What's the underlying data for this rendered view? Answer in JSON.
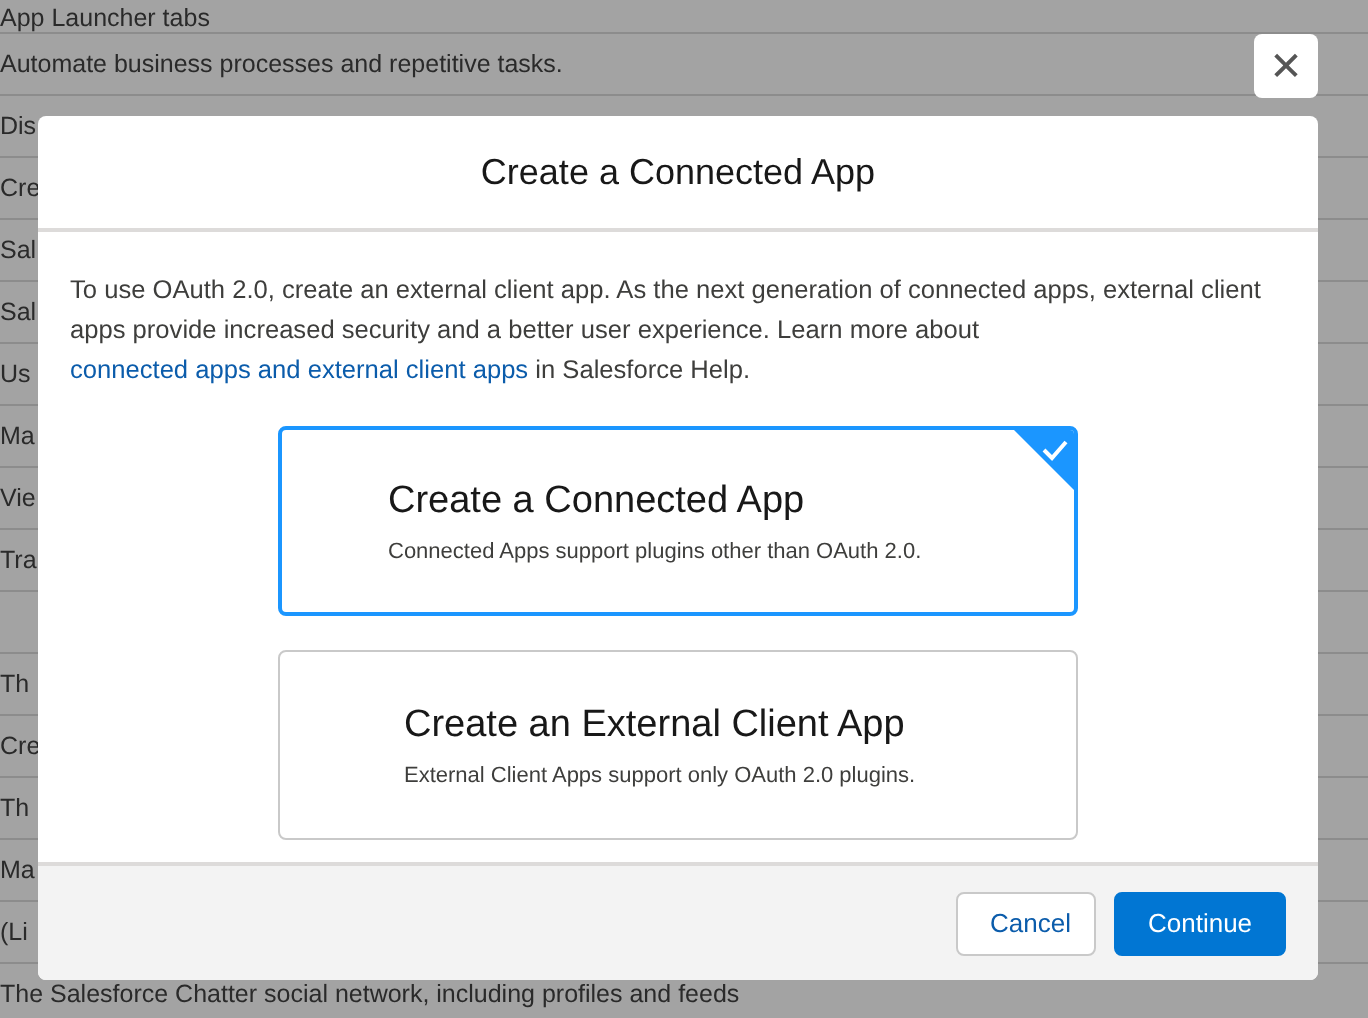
{
  "background_rows": [
    "App Launcher tabs",
    "Automate business processes and repetitive tasks.",
    "Dis",
    "Cre",
    "Sal",
    "Sal",
    "Us",
    "Ma",
    "Vie",
    "Tra",
    "",
    "Th",
    "Cre",
    "Th",
    "Ma",
    "(Li",
    "The Salesforce Chatter social network, including profiles and feeds"
  ],
  "close_button": {
    "label": "✕"
  },
  "modal": {
    "title": "Create a Connected App",
    "intro": {
      "text_before": "To use OAuth 2.0, create an external client app. As the next generation of connected apps, external client apps provide increased security and a better user experience. Learn more about ",
      "link": "connected apps and external client apps",
      "text_after": " in Salesforce Help."
    },
    "options": [
      {
        "title": "Create a Connected App",
        "description": "Connected Apps support plugins other than OAuth 2.0.",
        "selected": true
      },
      {
        "title": "Create an External Client App",
        "description": "External Client Apps support only OAuth 2.0 plugins.",
        "selected": false
      }
    ],
    "buttons": [
      {
        "label": "Cancel",
        "kind": "neutral"
      },
      {
        "label": "Continue",
        "kind": "brand"
      }
    ]
  }
}
